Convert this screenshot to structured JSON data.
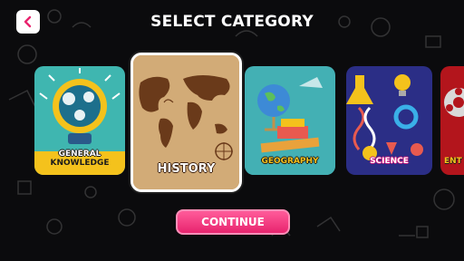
{
  "header": {
    "title": "SELECT CATEGORY",
    "back_icon": "chevron-left-icon"
  },
  "categories": [
    {
      "label_line1": "GENERAL",
      "label_line2": "KNOWLEDGE",
      "color": "#3fb6b0"
    },
    {
      "label": "HISTORY",
      "color": "#caa06a",
      "selected": true
    },
    {
      "label": "GEOGRAPHY",
      "color": "#43b0b4"
    },
    {
      "label": "SCIENCE",
      "color": "#2b2e86"
    },
    {
      "label": "ENT",
      "color": "#b3151c"
    }
  ],
  "footer": {
    "continue_label": "CONTINUE"
  },
  "colors": {
    "accent": "#e8246e",
    "back_arrow": "#e8246e",
    "background": "#0b0b0d"
  }
}
